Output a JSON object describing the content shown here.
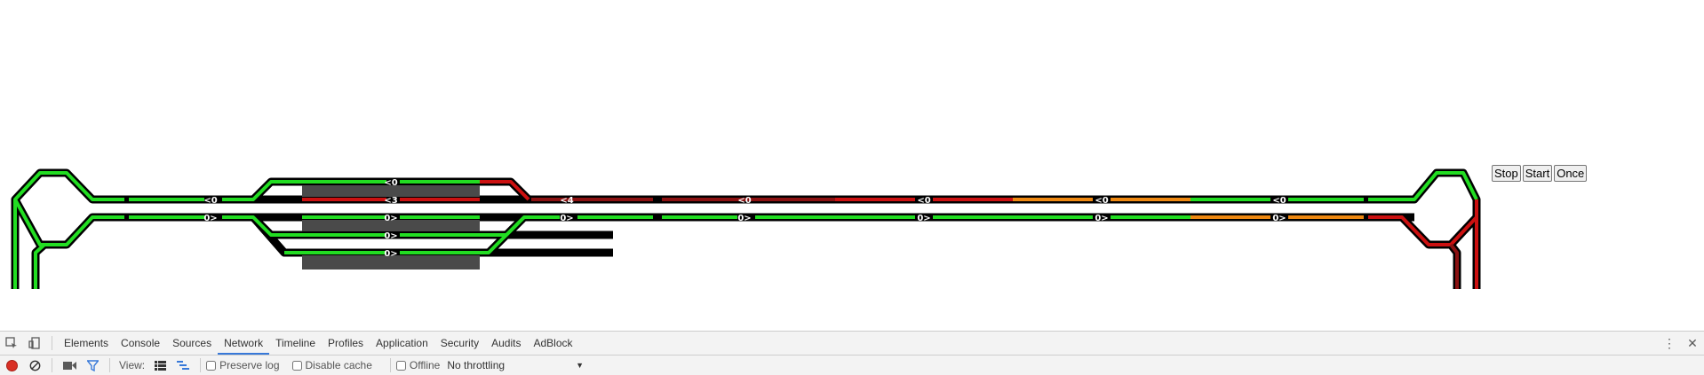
{
  "controls": {
    "stop_label": "Stop",
    "start_label": "Start",
    "once_label": "Once"
  },
  "signals": [
    {
      "id": "sig-1",
      "label": "<0"
    },
    {
      "id": "sig-2",
      "label": "<0"
    },
    {
      "id": "sig-3",
      "label": "0>"
    },
    {
      "id": "sig-4",
      "label": "<3"
    },
    {
      "id": "sig-5",
      "label": "0>"
    },
    {
      "id": "sig-6",
      "label": "0>"
    },
    {
      "id": "sig-7",
      "label": "0>"
    },
    {
      "id": "sig-8",
      "label": "<4"
    },
    {
      "id": "sig-9",
      "label": "0>"
    },
    {
      "id": "sig-10",
      "label": "<0"
    },
    {
      "id": "sig-11",
      "label": "0>"
    },
    {
      "id": "sig-12",
      "label": "<0"
    },
    {
      "id": "sig-13",
      "label": "0>"
    },
    {
      "id": "sig-14",
      "label": "<0"
    },
    {
      "id": "sig-15",
      "label": "0>"
    },
    {
      "id": "sig-16",
      "label": "<0"
    },
    {
      "id": "sig-17",
      "label": "0>"
    }
  ],
  "colors": {
    "free": "#22dd22",
    "occupied": "#cc1111",
    "reserved": "#ee8811",
    "blocked": "#8b1111",
    "rail": "#000000",
    "platform": "#4a4a4a"
  },
  "devtools": {
    "tabs": [
      "Elements",
      "Console",
      "Sources",
      "Network",
      "Timeline",
      "Profiles",
      "Application",
      "Security",
      "Audits",
      "AdBlock"
    ],
    "active_tab": "Network",
    "view_label": "View:",
    "preserve_log_label": "Preserve log",
    "disable_cache_label": "Disable cache",
    "offline_label": "Offline",
    "throttling_value": "No throttling"
  }
}
